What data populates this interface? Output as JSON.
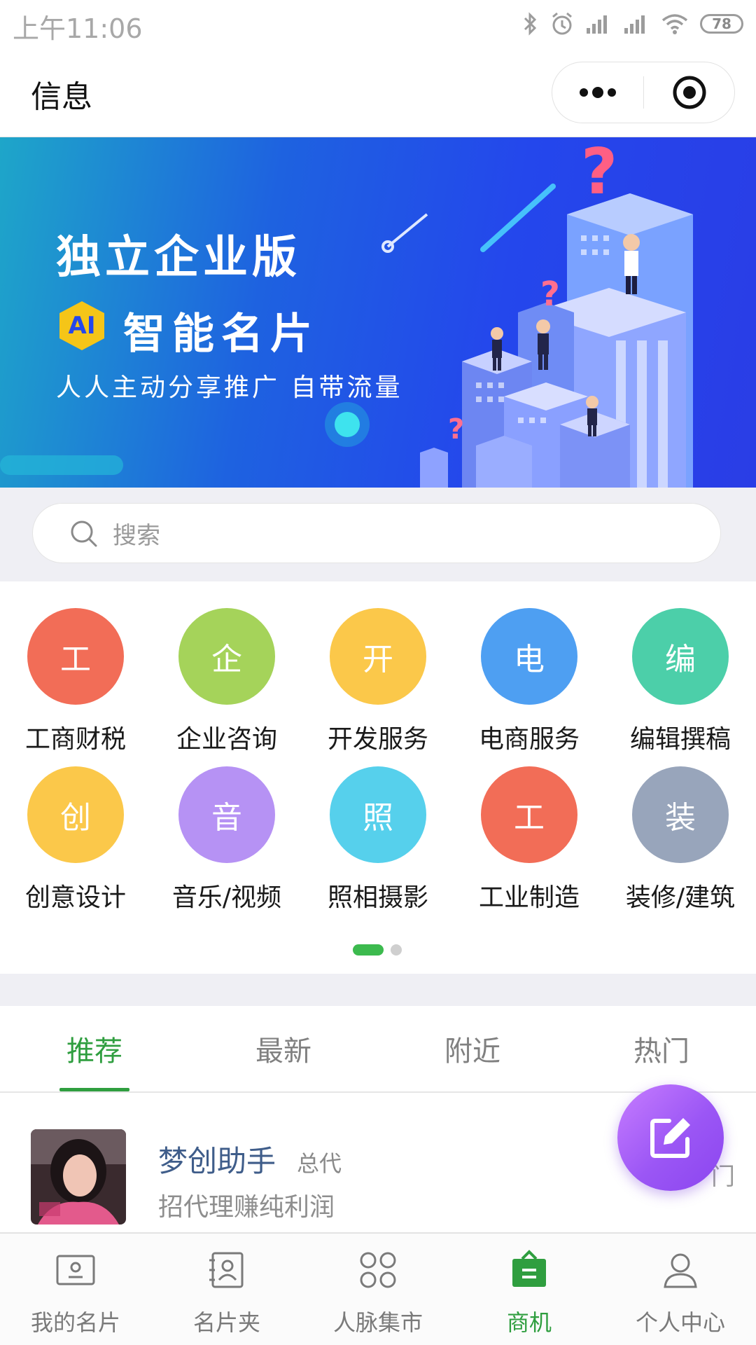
{
  "status_bar": {
    "time": "上午11:06",
    "battery": "78",
    "icons": [
      "bluetooth-icon",
      "alarm-icon",
      "signal-icon",
      "signal-icon",
      "wifi-icon",
      "battery-icon"
    ]
  },
  "header": {
    "title": "信息",
    "more_icon": "more-icon",
    "close_icon": "target-icon"
  },
  "banner": {
    "title": "独立企业版",
    "badge": "AI",
    "subtitle": "智能名片",
    "slogan": "人人主动分享推广  自带流量"
  },
  "search": {
    "placeholder": "搜索"
  },
  "categories": [
    {
      "char": "工",
      "label": "工商财税",
      "color": "#f26d57"
    },
    {
      "char": "企",
      "label": "企业咨询",
      "color": "#a5d35a"
    },
    {
      "char": "开",
      "label": "开发服务",
      "color": "#fbc84a"
    },
    {
      "char": "电",
      "label": "电商服务",
      "color": "#4e9ff2"
    },
    {
      "char": "编",
      "label": "编辑撰稿",
      "color": "#4ccfa9"
    },
    {
      "char": "创",
      "label": "创意设计",
      "color": "#fbc84a"
    },
    {
      "char": "音",
      "label": "音乐/视频",
      "color": "#b692f4"
    },
    {
      "char": "照",
      "label": "照相摄影",
      "color": "#56d0ec"
    },
    {
      "char": "工",
      "label": "工业制造",
      "color": "#f26d57"
    },
    {
      "char": "装",
      "label": "装修/建筑",
      "color": "#98a5bb"
    }
  ],
  "pager": {
    "pages": 2,
    "active": 0
  },
  "tabs": [
    {
      "label": "推荐",
      "active": true
    },
    {
      "label": "最新",
      "active": false
    },
    {
      "label": "附近",
      "active": false
    },
    {
      "label": "热门",
      "active": false
    }
  ],
  "list_items": [
    {
      "name": "梦创助手",
      "role": "总代",
      "desc": "招代理赚纯利润",
      "edge_text": "门"
    }
  ],
  "fab": {
    "icon": "edit-icon"
  },
  "bottom_nav": [
    {
      "label": "我的名片",
      "icon": "card-icon",
      "active": false
    },
    {
      "label": "名片夹",
      "icon": "contacts-icon",
      "active": false
    },
    {
      "label": "人脉集市",
      "icon": "grid-icon",
      "active": false
    },
    {
      "label": "商机",
      "icon": "bag-icon",
      "active": true
    },
    {
      "label": "个人中心",
      "icon": "person-icon",
      "active": false
    }
  ],
  "colors": {
    "accent_green": "#2f9e3f",
    "fab_purple": "#9b56f5",
    "banner_blue": "#2447ec"
  }
}
